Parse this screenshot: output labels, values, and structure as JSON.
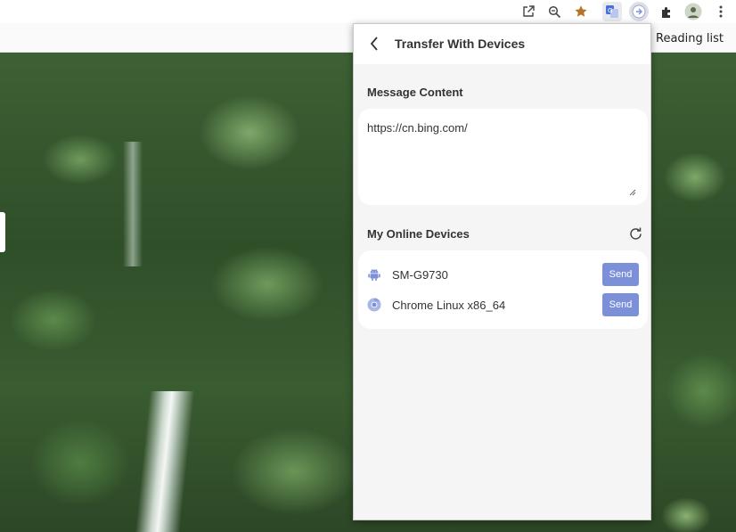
{
  "browser": {
    "reading_list_label": "Reading list",
    "toolbar_icons": [
      "open-in-new-icon",
      "zoom-icon",
      "star-icon",
      "translate-icon",
      "transfer-extension-icon",
      "extensions-icon",
      "profile-avatar",
      "menu-icon"
    ],
    "star_color": "#b8732a"
  },
  "popup": {
    "title": "Transfer With Devices",
    "message_section_title": "Message Content",
    "message_text": "https://cn.bing.com/",
    "devices_section_title": "My Online Devices",
    "devices": [
      {
        "name": "SM-G9730",
        "icon": "android-icon",
        "send_label": "Send"
      },
      {
        "name": "Chrome Linux x86_64",
        "icon": "chrome-icon",
        "send_label": "Send"
      }
    ],
    "accent_color": "#7c8fd9"
  }
}
